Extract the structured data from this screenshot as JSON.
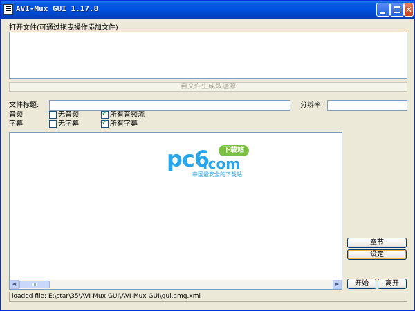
{
  "window": {
    "title": "AVI-Mux GUI 1.17.8",
    "titlebar_color": "#0054E3"
  },
  "open_files": {
    "label": "打开文件(可通过拖曳操作添加文件)"
  },
  "generate_button": {
    "label": "自文件生成数据源"
  },
  "file_title": {
    "label": "文件标题:",
    "value": ""
  },
  "resolution": {
    "label": "分辨率:",
    "value": ""
  },
  "audio": {
    "label": "音频",
    "no_audio": {
      "label": "无音频",
      "checked": false
    },
    "all_audio": {
      "label": "所有音频流",
      "checked": true
    }
  },
  "subtitles": {
    "label": "字幕",
    "no_subs": {
      "label": "无字幕",
      "checked": false
    },
    "all_subs": {
      "label": "所有字幕",
      "checked": true
    }
  },
  "watermark": {
    "logo": "pc6",
    "domain": ".com",
    "badge": "下载站",
    "tagline": "中国最安全的下载站",
    "color": "#29A5EB"
  },
  "buttons": {
    "chapters": "章节",
    "settings": "设定",
    "start": "开始",
    "exit": "离开"
  },
  "status": {
    "text": "loaded file: E:\\star\\35\\AVI-Mux GUI\\AVI-Mux GUI\\gui.amg.xml"
  }
}
